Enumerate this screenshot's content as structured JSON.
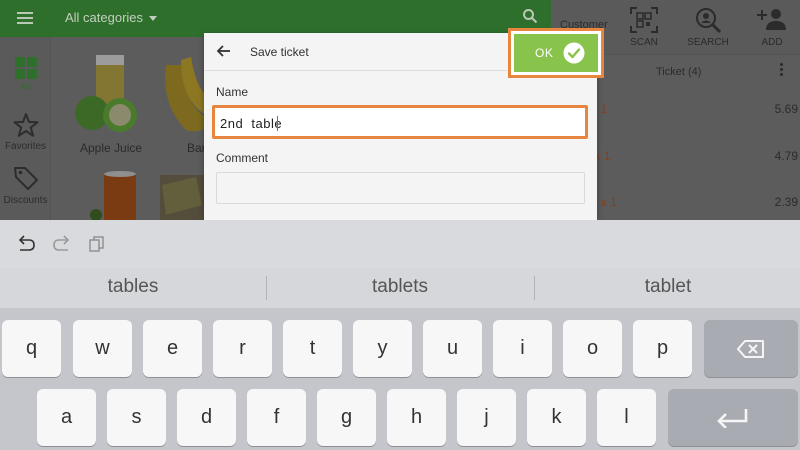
{
  "top_bar": {
    "category_label": "All categories"
  },
  "sidebar": {
    "items": [
      {
        "label": "All",
        "icon": "grid-icon",
        "active": true
      },
      {
        "label": "Favorites",
        "icon": "star-icon"
      },
      {
        "label": "Discounts",
        "icon": "tag-icon"
      }
    ]
  },
  "products": [
    {
      "label": "Apple Juice"
    },
    {
      "label": "Ban"
    }
  ],
  "right_panel": {
    "customer_label": "Customer",
    "buttons": [
      {
        "label": "SCAN",
        "icon": "barcode-scan-icon"
      },
      {
        "label": "SEARCH",
        "icon": "search-person-icon"
      },
      {
        "label": "ADD",
        "icon": "add-person-icon"
      }
    ],
    "ticket_title": "Ticket (4)",
    "lines": [
      {
        "name": "",
        "qty": "x 1",
        "price": "5.69"
      },
      {
        "name": "nt",
        "qty": "x 1",
        "price": "4.79"
      },
      {
        "name": "ea",
        "qty": "x 1",
        "price": "2.39"
      }
    ]
  },
  "dialog": {
    "title": "Save ticket",
    "name_label": "Name",
    "name_value": "2nd  table",
    "comment_label": "Comment",
    "comment_value": "",
    "ok_label": "OK"
  },
  "keyboard": {
    "suggestions": [
      "tables",
      "tablets",
      "tablet"
    ],
    "row1": [
      "q",
      "w",
      "e",
      "r",
      "t",
      "y",
      "u",
      "i",
      "o",
      "p"
    ],
    "row2": [
      "a",
      "s",
      "d",
      "f",
      "g",
      "h",
      "j",
      "k",
      "l"
    ]
  },
  "colors": {
    "accent_green": "#88c34c",
    "highlight_orange": "#e8853e",
    "topbar_green": "#2f6f2c"
  }
}
